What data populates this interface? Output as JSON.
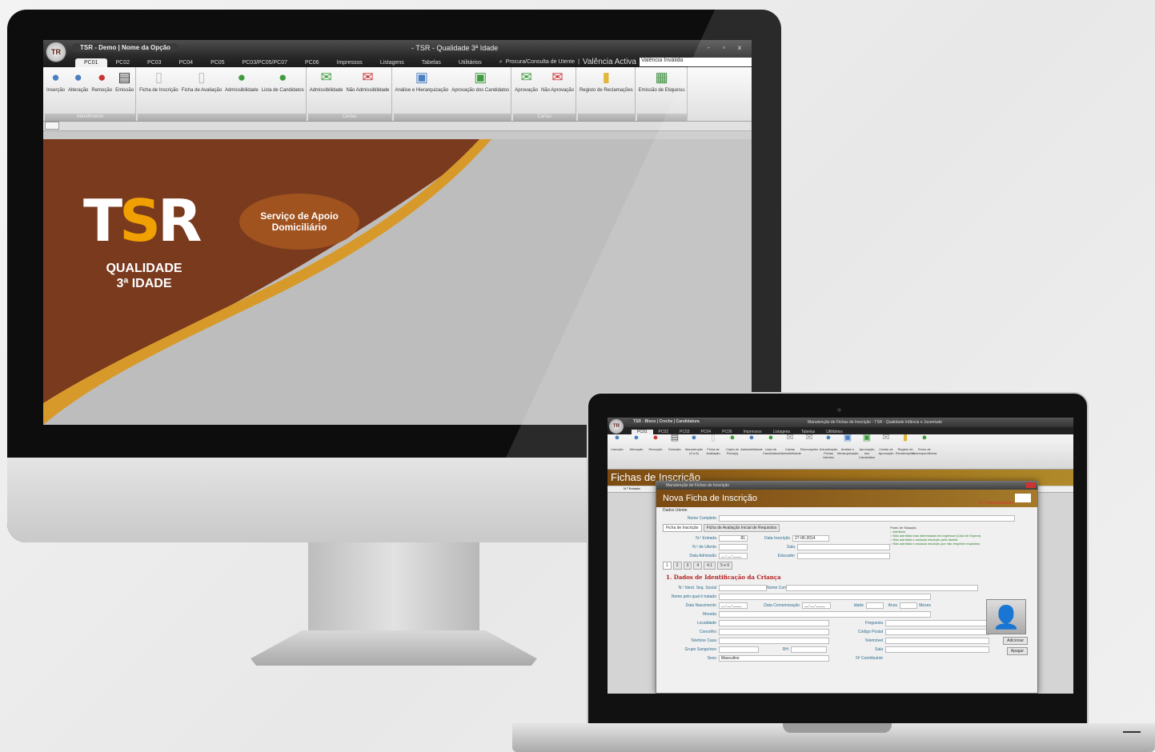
{
  "desktop": {
    "titlebar": {
      "orb": "TR",
      "left": "TSR - Demo  |  Nome da Opção",
      "center": "- TSR - Qualidade 3ª Idade",
      "controls": "- ▫ x"
    },
    "tabs": [
      "PC01",
      "PC02",
      "PC03",
      "PC04",
      "PC05",
      "PC03/PC05/PC07",
      "PC06",
      "Impressos",
      "Listagens",
      "Tabelas",
      "Utilitários"
    ],
    "search": {
      "link": "Procura/Consulta de Utente",
      "label": "Valência Activa",
      "value": "Valência Inválida"
    },
    "ribbon_groups": [
      {
        "label": "Atendimento",
        "buttons": [
          "Inserção",
          "Alteração",
          "Remoção",
          "Emissão"
        ]
      },
      {
        "label": "",
        "buttons": [
          "Ficha de Inscrição",
          "Ficha de Avaliação",
          "Admissibilidade",
          "Lista de Candidatos"
        ]
      },
      {
        "label": "Cartas",
        "buttons": [
          "Admissibilidade",
          "Não Admissibilidade"
        ]
      },
      {
        "label": "",
        "buttons": [
          "Análise e Hierarquização",
          "Aprovação dos Candidatos"
        ]
      },
      {
        "label": "Cartas",
        "buttons": [
          "Aprovação",
          "Não Aprovação"
        ]
      },
      {
        "label": "",
        "buttons": [
          "Registo de Reclamações"
        ]
      },
      {
        "label": "",
        "buttons": [
          "Emissão de Etiquetas"
        ]
      }
    ],
    "splash": {
      "logo_t": "T",
      "logo_s": "S",
      "logo_r": "R",
      "quality": "QUALIDADE\n3ª IDADE",
      "service": "Serviço de Apoio\nDomiciliário"
    }
  },
  "laptop": {
    "titlebar": {
      "orb": "TR",
      "left": "TSR - Bloco | Creche | Candidatura",
      "center": "Manutenção de Fichas de Inscrição - TSR - Qualidade Infância e Juventude"
    },
    "tabs": [
      "PC01",
      "PC02",
      "PC03",
      "PC04",
      "PC06",
      "Impressos",
      "Listagens",
      "Tabelas",
      "Utilitários"
    ],
    "ribbon_buttons": [
      "Inserção",
      "Alteração",
      "Remoção",
      "Emissão",
      "Manutenção (3 a 6)",
      "Ficha de Avaliação",
      "Cópia de Ficha(s)",
      "Admissibilidade",
      "Lista de Candidatos",
      "Cartas Admissibilidade",
      "Renovações",
      "Actualização Fichas Utentes",
      "Análise e Hierarquização",
      "Aprovação dos Candidatos",
      "Cartas de Aprovação",
      "Registo de Reclamações",
      "Envio de Correspondência"
    ],
    "page_title": "Fichas de Inscrição",
    "grid_header": "N.º Entrada",
    "dialog": {
      "window_title": "Manutenção de Fichas de Inscrição",
      "title": "Nova Ficha de Inscrição",
      "nr_label": "N.º Processamento",
      "section": "Dados Utente",
      "nome_label": "Nome Completo",
      "tabs": [
        "Ficha de Inscrição",
        "Ficha de Avaliação Inicial de Requisitos"
      ],
      "fields": {
        "entrada_label": "N.º Entrada",
        "entrada_value": "81",
        "data_inscricao_label": "Data Inscrição",
        "data_inscricao_value": "27-06-2014",
        "utente_label": "N.º de Utente",
        "sala_label": "Sala",
        "admissao_label": "Data Admissão",
        "educador_label": "Educador"
      },
      "situacao": {
        "title": "Ponto de Situação",
        "options": [
          "Admitida",
          "Não admitida mas interessada em ingressar (Lista de Espera)",
          "Não admitida e anulada inscrição pela família",
          "Não admitida e anulada inscrição por não respeitar requisitos"
        ]
      },
      "subtabs": [
        "1",
        "2",
        "3",
        "4",
        "4.1",
        "5 e 6"
      ],
      "section_title": "1. Dados de Identificação da Criança",
      "form": {
        "seg_social": "N.º Ident. Seg. Social",
        "nome_completo": "Nome Completo",
        "nome_pais": "Nome pelo qual é tratado",
        "data_nasc": "Data Nascimento",
        "data_comem": "Data Comemoração",
        "idade": "Idade",
        "anos": "Anos",
        "meses": "Meses",
        "morada": "Morada",
        "localidade": "Localidade",
        "freguesia": "Freguesia",
        "concelho": "Concelho",
        "codigo_postal": "Código Postal",
        "tel_casa": "Telefone Casa",
        "telemovel": "Telemóvel",
        "grupo_sang": "Grupo Sanguíneo",
        "rh": "RH",
        "sala": "Sala",
        "sexo": "Sexo",
        "sexo_value": "Masculino",
        "contribuinte": "Nº Contribuinte",
        "date_mask": "__-__-____"
      },
      "buttons": {
        "adicionar": "Adicionar",
        "apagar": "Apagar"
      }
    }
  },
  "colors": {
    "brown": "#7a3a1e",
    "orange": "#f0a000",
    "green_text": "#2e7e2e",
    "blue_label": "#2b6d8f",
    "red_title": "#b41e1e"
  }
}
